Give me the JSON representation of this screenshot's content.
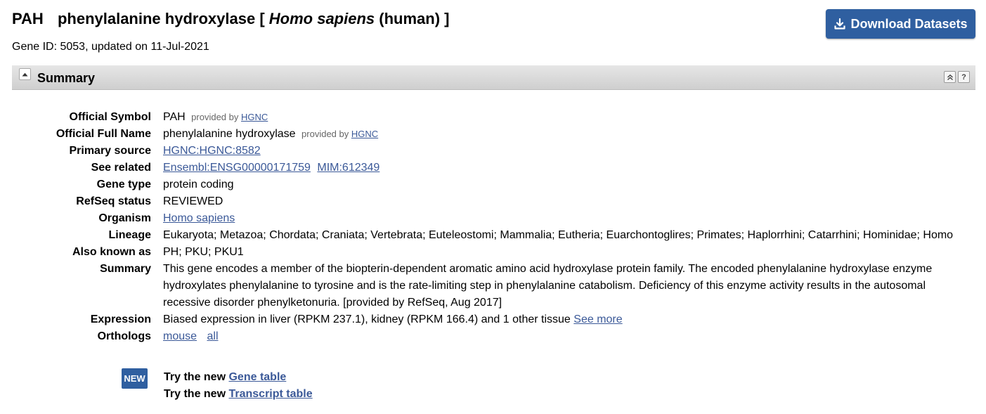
{
  "header": {
    "symbol": "PAH",
    "name": "phenylalanine hydroxylase",
    "bracket_open": "[",
    "organism_italic": "Homo sapiens",
    "organism_common": "(human)",
    "bracket_close": "]",
    "gene_id_line": "Gene ID: 5053, updated on 11-Jul-2021",
    "download_label": "Download Datasets"
  },
  "summary_section": {
    "title": "Summary",
    "collapse_icon": "collapse-up-icon",
    "icons": [
      "scroll-top-icon",
      "help-icon"
    ],
    "help_glyph": "?"
  },
  "fields": {
    "official_symbol": {
      "label": "Official Symbol",
      "value": "PAH",
      "provided_by": "provided by",
      "provider": "HGNC"
    },
    "official_full_name": {
      "label": "Official Full Name",
      "value": "phenylalanine hydroxylase",
      "provided_by": "provided by",
      "provider": "HGNC"
    },
    "primary_source": {
      "label": "Primary source",
      "link": "HGNC:HGNC:8582"
    },
    "see_related": {
      "label": "See related",
      "links": [
        "Ensembl:ENSG00000171759",
        "MIM:612349"
      ]
    },
    "gene_type": {
      "label": "Gene type",
      "value": "protein coding"
    },
    "refseq_status": {
      "label": "RefSeq status",
      "value": "REVIEWED"
    },
    "organism": {
      "label": "Organism",
      "link": "Homo sapiens"
    },
    "lineage": {
      "label": "Lineage",
      "value": "Eukaryota; Metazoa; Chordata; Craniata; Vertebrata; Euteleostomi; Mammalia; Eutheria; Euarchontoglires; Primates; Haplorrhini; Catarrhini; Hominidae; Homo"
    },
    "also_known_as": {
      "label": "Also known as",
      "value": "PH; PKU; PKU1"
    },
    "summary": {
      "label": "Summary",
      "value": "This gene encodes a member of the biopterin-dependent aromatic amino acid hydroxylase protein family. The encoded phenylalanine hydroxylase enzyme hydroxylates phenylalanine to tyrosine and is the rate-limiting step in phenylalanine catabolism. Deficiency of this enzyme activity results in the autosomal recessive disorder phenylketonuria. [provided by RefSeq, Aug 2017]"
    },
    "expression": {
      "label": "Expression",
      "value": "Biased expression in liver (RPKM 237.1), kidney (RPKM 166.4) and 1 other tissue",
      "link": "See more"
    },
    "orthologs": {
      "label": "Orthologs",
      "links": [
        "mouse",
        "all"
      ]
    }
  },
  "new_features": {
    "badge": "NEW",
    "try_prefix": "Try the new",
    "gene_table_link": "Gene table",
    "transcript_table_link": "Transcript table"
  },
  "colors": {
    "accent": "#2f5fa0",
    "link": "#3b5998",
    "bar": "#d9d9d9"
  }
}
